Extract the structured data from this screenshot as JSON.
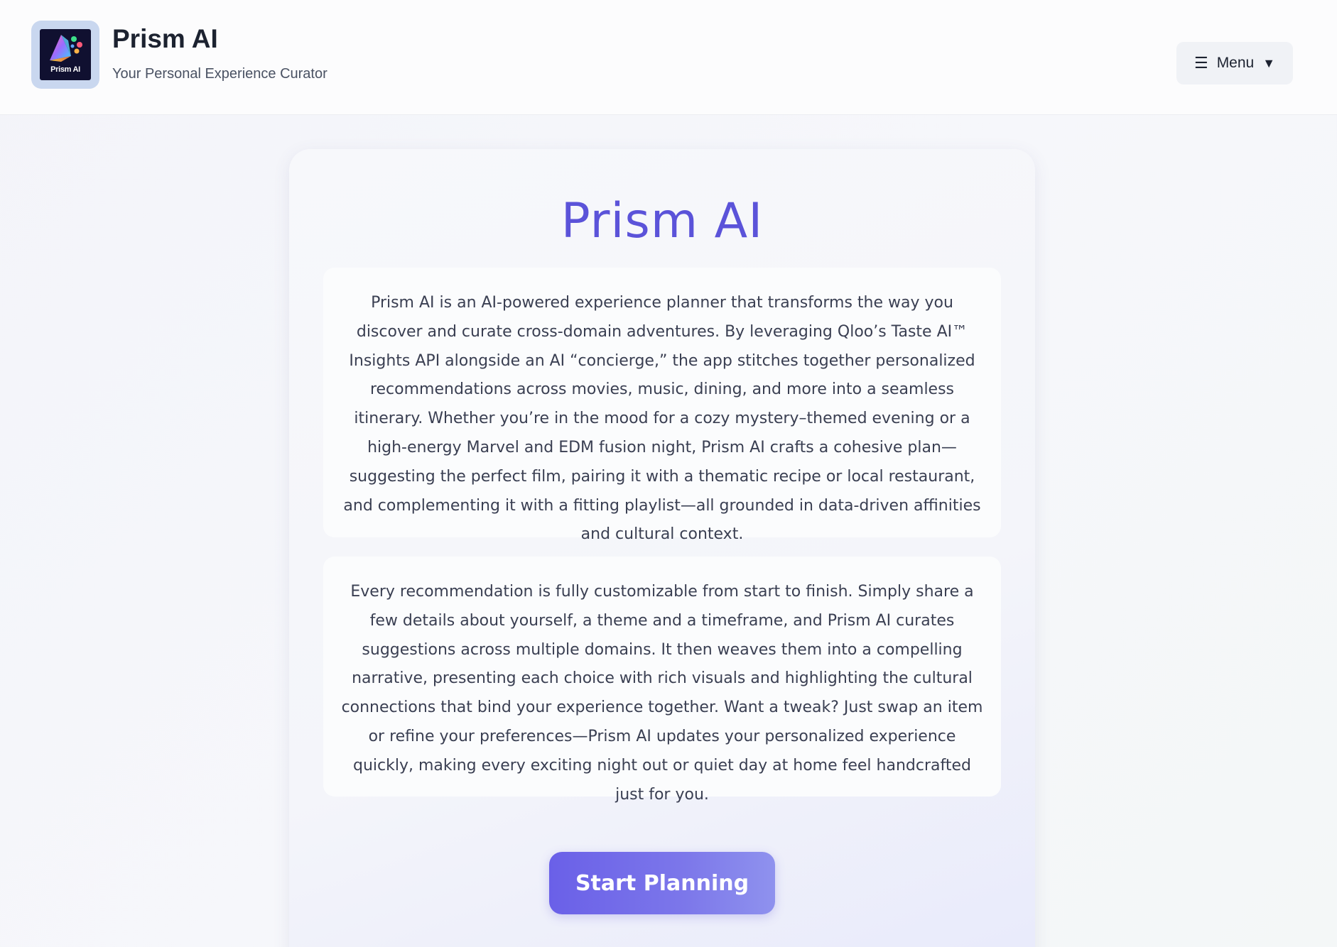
{
  "header": {
    "logo_text": "Prism AI",
    "title": "Prism AI",
    "subtitle": "Your Personal Experience Curator",
    "menu": {
      "icon": "hamburger-icon",
      "label": "Menu",
      "caret_icon": "caret-down-icon"
    }
  },
  "main": {
    "title": "Prism AI",
    "paragraphs": [
      "Prism AI is an AI-powered experience planner that transforms the way you discover and curate cross-domain adventures. By leveraging Qloo’s Taste AI™ Insights API alongside an AI “concierge,” the app stitches together personalized recommendations across movies, music, dining, and more into a seamless itinerary. Whether you’re in the mood for a cozy mystery–themed evening or a high-energy Marvel and EDM fusion night, Prism AI crafts a cohesive plan—suggesting the perfect film, pairing it with a thematic recipe or local restaurant, and complementing it with a fitting playlist—all grounded in data-driven affinities and cultural context.",
      "Every recommendation is fully customizable from start to finish. Simply share a few details about yourself, a theme and a timeframe, and Prism AI curates suggestions across multiple domains. It then weaves them into a compelling narrative, presenting each choice with rich visuals and highlighting the cultural connections that bind your experience together. Want a tweak? Just swap an item or refine your preferences—Prism AI updates your personalized experience quickly, making every exciting night out or quiet day at home feel handcrafted just for you."
    ],
    "cta_label": "Start Planning"
  },
  "colors": {
    "accent": "#5b53d9",
    "button_start": "#6a60e8",
    "button_end": "#8f92ee",
    "text_dark": "#1c2230"
  }
}
